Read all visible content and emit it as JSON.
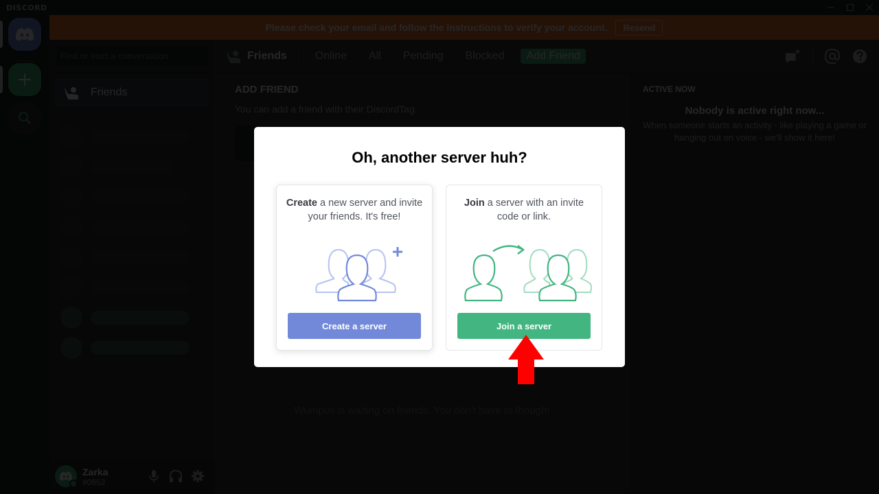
{
  "window": {
    "brand": "DISCORD",
    "controls": [
      "minimize",
      "maximize",
      "close"
    ]
  },
  "notice": {
    "text": "Please check your email and follow the instructions to verify your account.",
    "action": "Resend"
  },
  "sidebar": {
    "search_placeholder": "Find or start a conversation",
    "friends_label": "Friends"
  },
  "user": {
    "name": "Zarka",
    "tag": "#0652"
  },
  "topbar": {
    "title": "Friends",
    "tabs": [
      {
        "label": "Online"
      },
      {
        "label": "All"
      },
      {
        "label": "Pending"
      },
      {
        "label": "Blocked"
      },
      {
        "label": "Add Friend"
      }
    ]
  },
  "add_friend": {
    "heading": "ADD FRIEND",
    "subtitle": "You can add a friend with their DiscordTag."
  },
  "empty_state": "Wumpus is waiting on friends. You don't have to though!",
  "active_now": {
    "heading": "ACTIVE NOW",
    "title": "Nobody is active right now...",
    "body": "When someone starts an activity - like playing a game or hanging out on voice - we'll show it here!"
  },
  "modal": {
    "title": "Oh, another server huh?",
    "create": {
      "bold": "Create",
      "rest": " a new server and invite your friends. It's free!",
      "button": "Create a server"
    },
    "join": {
      "bold": "Join",
      "rest": " a server with an invite code or link.",
      "button": "Join a server"
    }
  },
  "colors": {
    "blurple": "#7289da",
    "green": "#43b581",
    "notice_orange": "#f57731",
    "annotation_arrow": "#ff0000"
  }
}
